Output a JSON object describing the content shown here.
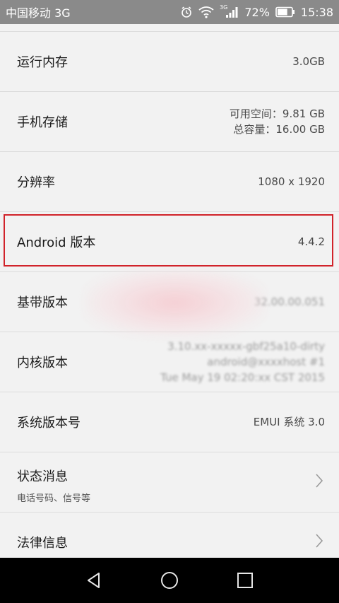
{
  "status_bar": {
    "carrier": "中国移动 3G",
    "net_mini": "3G",
    "battery_percent": "72%",
    "time": "15:38",
    "battery_level": 0.72,
    "icons": [
      "alarm-clock-icon",
      "wifi-icon",
      "signal-icon",
      "battery-icon"
    ]
  },
  "rows": [
    {
      "label": "运行内存",
      "value": "3.0GB"
    },
    {
      "label": "手机存储",
      "value_line1": "可用空间：9.81 GB",
      "value_line2": "总容量：16.00 GB"
    },
    {
      "label": "分辨率",
      "value": "1080 x 1920"
    },
    {
      "label": "Android 版本",
      "value": "4.4.2"
    },
    {
      "label": "基带版本",
      "value": "32.00.00.051"
    },
    {
      "label": "内核版本",
      "value_line1": "3.10.xx-xxxxx-gbf25a10-dirty",
      "value_line2": "android@xxxxhost #1",
      "value_line3": "Tue May 19 02:20:xx CST 2015"
    },
    {
      "label": "系统版本号",
      "value": "EMUI 系统 3.0"
    },
    {
      "label": "状态消息",
      "sub": "电话号码、信号等"
    },
    {
      "label": "法律信息"
    }
  ],
  "colors": {
    "status_bar_bg": "#8a8a8a",
    "highlight": "#d1232a",
    "nav_bar_bg": "#000000"
  }
}
